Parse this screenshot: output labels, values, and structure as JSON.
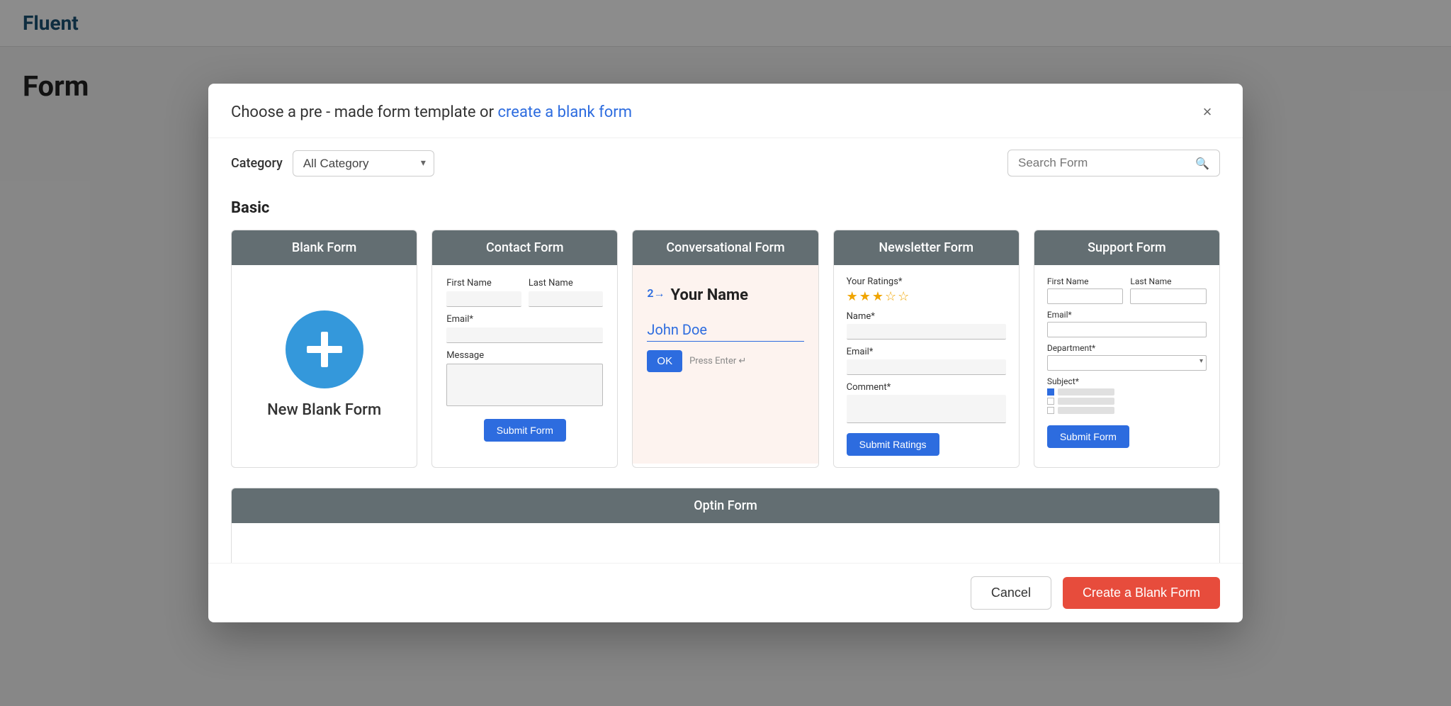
{
  "background": {
    "logo": "Fluent",
    "page_title": "Form"
  },
  "modal": {
    "title_static": "Choose a pre - made form template or",
    "title_link": "create a blank form",
    "close_label": "×",
    "category_label": "Category",
    "category_default": "All Category",
    "search_placeholder": "Search Form",
    "section_basic": "Basic",
    "templates": [
      {
        "id": "blank",
        "header": "Blank Form",
        "body_label": "New Blank Form"
      },
      {
        "id": "contact",
        "header": "Contact Form",
        "fields": {
          "first_name_label": "First Name",
          "last_name_label": "Last Name",
          "email_label": "Email*",
          "message_label": "Message",
          "submit_label": "Submit Form"
        }
      },
      {
        "id": "conversational",
        "header": "Conversational Form",
        "step_num": "2→",
        "question": "Your Name",
        "answer": "John Doe",
        "ok_label": "OK",
        "enter_hint": "Press Enter ↵"
      },
      {
        "id": "newsletter",
        "header": "Newsletter Form",
        "ratings_label": "Your Ratings*",
        "stars_filled": 3,
        "stars_total": 5,
        "name_label": "Name*",
        "email_label": "Email*",
        "comment_label": "Comment*",
        "submit_label": "Submit Ratings"
      },
      {
        "id": "support",
        "header": "Support Form",
        "first_name_label": "First Name",
        "last_name_label": "Last Name",
        "email_label": "Email*",
        "department_label": "Department*",
        "subject_label": "Subject*",
        "submit_label": "Submit Form"
      }
    ],
    "second_row_templates": [
      {
        "id": "optin",
        "header": "Optin Form"
      }
    ],
    "footer": {
      "cancel_label": "Cancel",
      "create_blank_label": "Create a Blank Form"
    }
  }
}
